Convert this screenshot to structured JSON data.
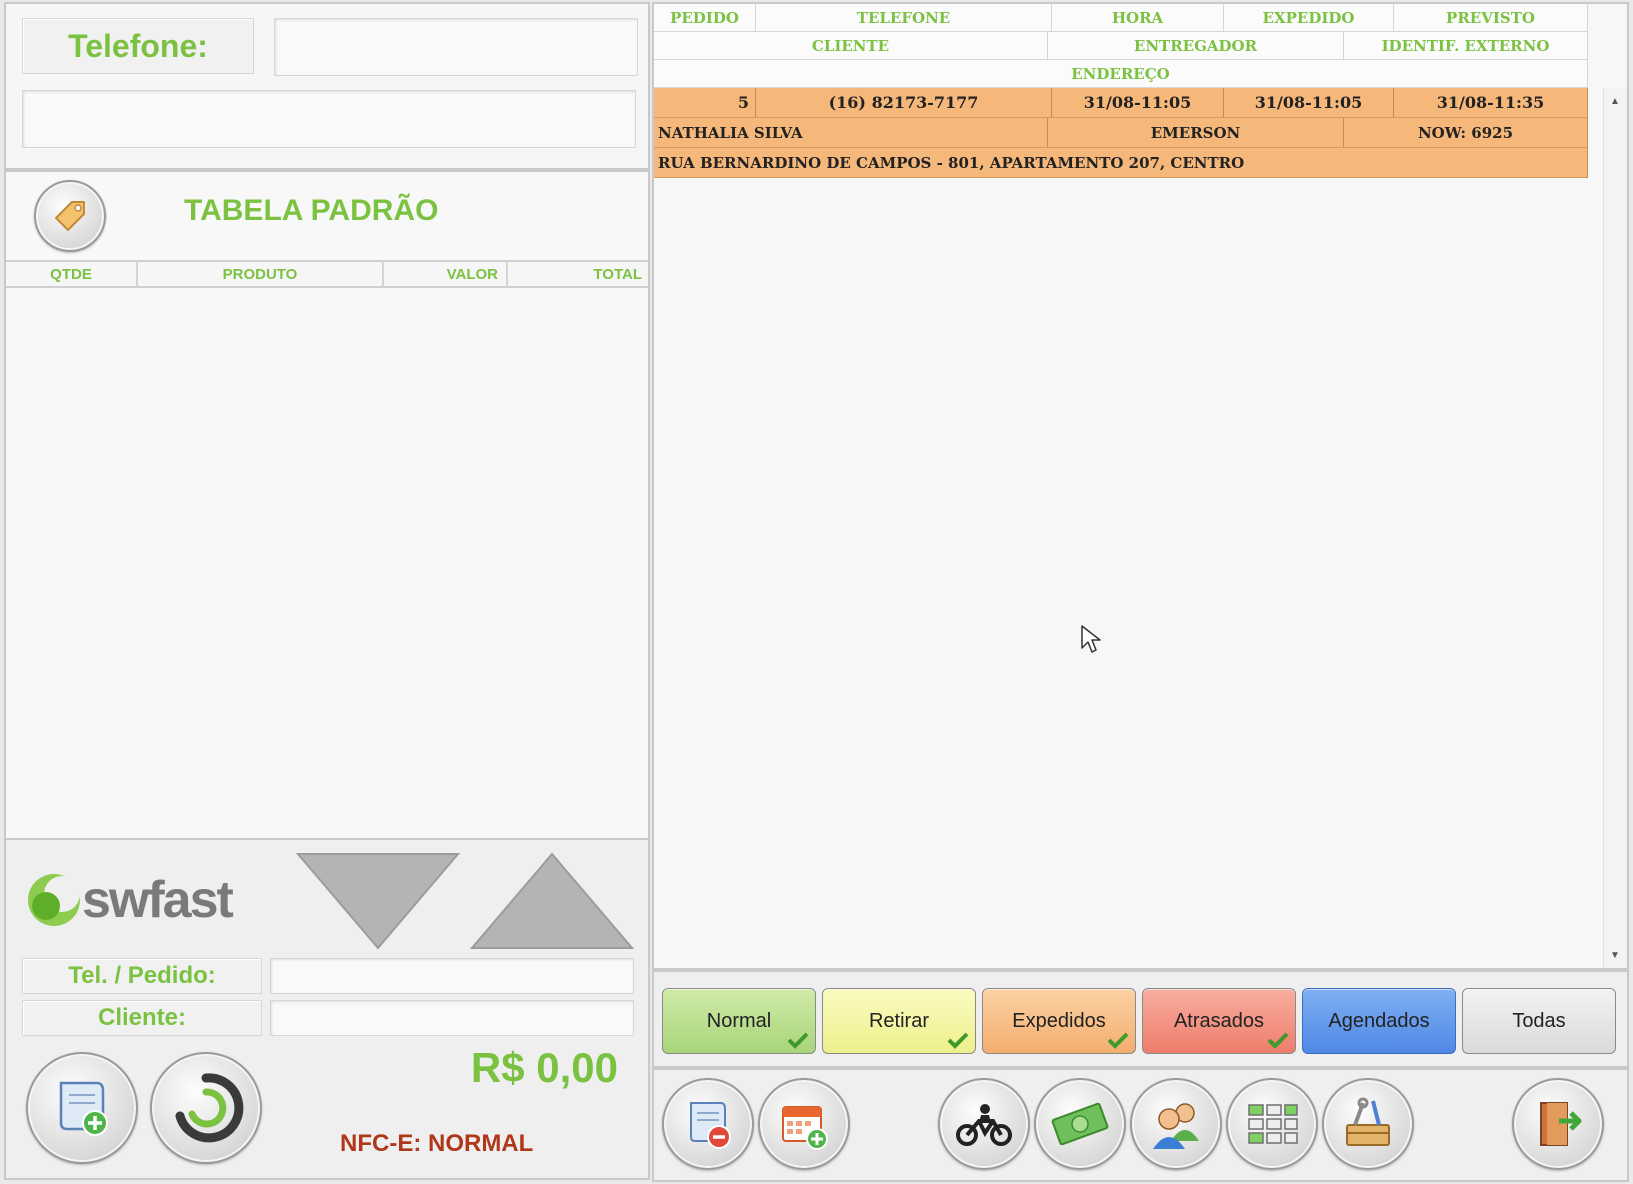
{
  "phone": {
    "label": "Telefone:",
    "value": "",
    "secondary_value": ""
  },
  "table": {
    "title": "TABELA PADRÃO",
    "columns": [
      "QTDE",
      "PRODUTO",
      "VALOR",
      "TOTAL"
    ],
    "rows": []
  },
  "brand": {
    "logo_text": "swfast"
  },
  "lookup": {
    "tel_label": "Tel. / Pedido:",
    "tel_value": "",
    "client_label": "Cliente:",
    "client_value": ""
  },
  "totals": {
    "amount": "R$ 0,00",
    "nfce": "NFC-E: NORMAL"
  },
  "orders": {
    "header_row1": [
      "PEDIDO",
      "TELEFONE",
      "HORA",
      "EXPEDIDO",
      "PREVISTO"
    ],
    "header_row2": [
      "CLIENTE",
      "ENTREGADOR",
      "IDENTIF. EXTERNO"
    ],
    "header_row3": [
      "ENDEREÇO"
    ],
    "items": [
      {
        "pedido": "5",
        "telefone": "(16) 82173-7177",
        "hora": "31/08-11:05",
        "expedido": "31/08-11:05",
        "previsto": "31/08-11:35",
        "cliente": "NATHALIA SILVA",
        "entregador": "EMERSON",
        "identif_externo": "NOW: 6925",
        "endereco": "RUA BERNARDINO DE CAMPOS - 801, APARTAMENTO 207, CENTRO",
        "color": "#f6b77a"
      }
    ]
  },
  "filters": [
    {
      "label": "Normal",
      "color": "#b7df8a",
      "checked": true
    },
    {
      "label": "Retirar",
      "color": "#f4f59c",
      "checked": true
    },
    {
      "label": "Expedidos",
      "color": "#f7b879",
      "checked": true
    },
    {
      "label": "Atrasados",
      "color": "#f08a78",
      "checked": true
    },
    {
      "label": "Agendados",
      "color": "#5e97ea",
      "checked": false
    },
    {
      "label": "Todas",
      "color": "#e6e6e6",
      "checked": false
    }
  ],
  "toolbar_icons": [
    "remove-order-icon",
    "schedule-add-icon",
    "motorcycle-icon",
    "money-icon",
    "customers-icon",
    "tables-icon",
    "tools-icon",
    "exit-door-icon"
  ],
  "colors": {
    "accent_green": "#7cc242",
    "order_orange": "#f6b77a",
    "nfce_red": "#b0371a"
  }
}
